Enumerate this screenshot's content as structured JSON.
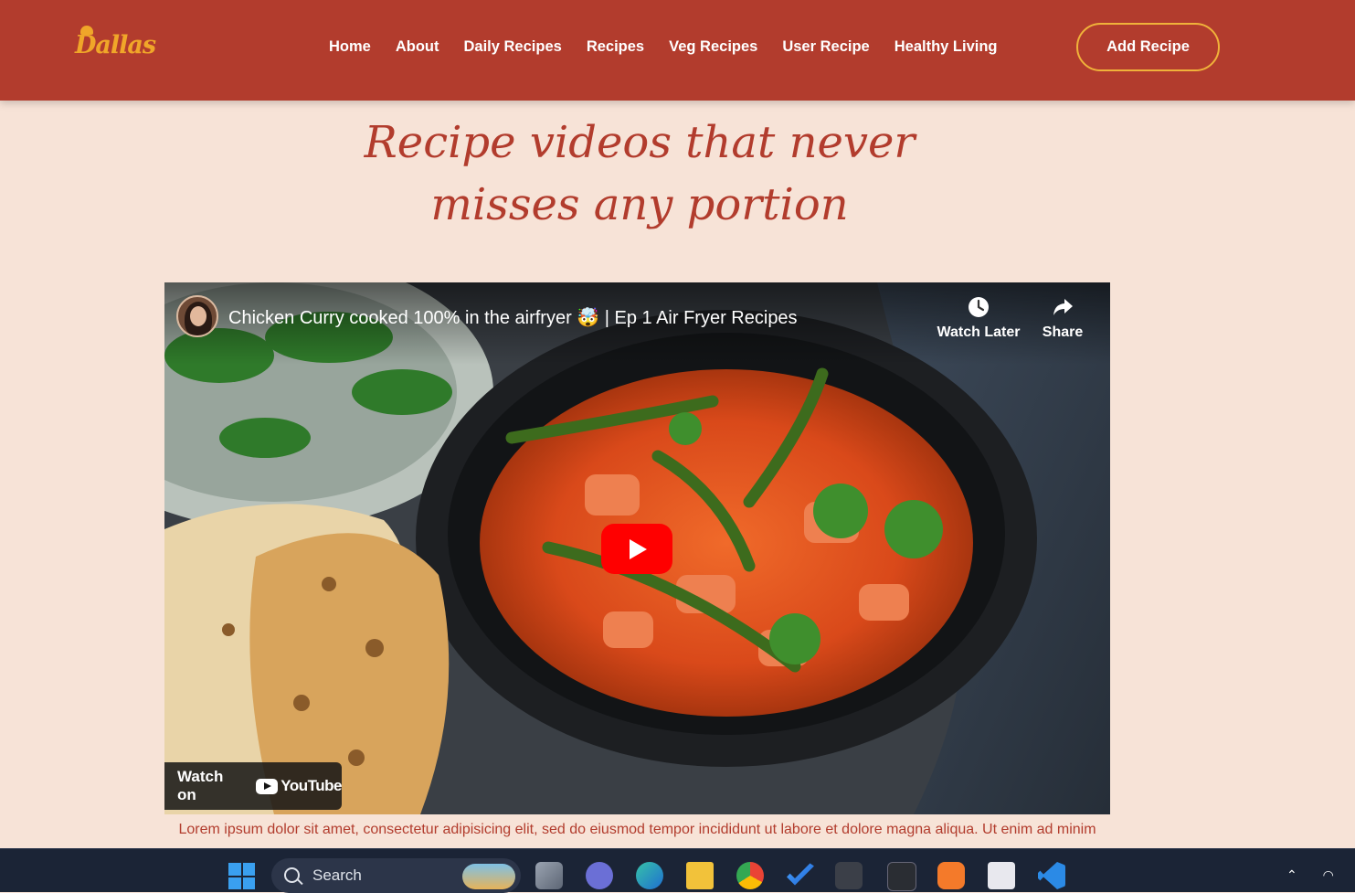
{
  "brand": {
    "logo_text": "Dallas"
  },
  "nav": {
    "items": [
      "Home",
      "About",
      "Daily Recipes",
      "Recipes",
      "Veg Recipes",
      "User Recipe",
      "Healthy Living"
    ],
    "cta": "Add Recipe"
  },
  "hero": {
    "line1": "Recipe videos that never",
    "line2": "misses any portion"
  },
  "video": {
    "title": "Chicken Curry cooked 100% in the airfryer 🤯 | Ep 1 Air Fryer Recipes",
    "watch_later": "Watch Later",
    "share": "Share",
    "watch_on": "Watch on",
    "youtube": "YouTube"
  },
  "description": "Lorem ipsum dolor sit amet, consectetur adipisicing elit, sed do eiusmod tempor incididunt ut labore et dolore magna aliqua. Ut enim ad minim",
  "taskbar": {
    "search_placeholder": "Search",
    "apps": [
      "task-view",
      "teams",
      "edge",
      "file-explorer",
      "chrome",
      "todo",
      "chrome-profile",
      "terminal",
      "xampp",
      "snipping-tool",
      "vscode"
    ]
  },
  "colors": {
    "nav_bg": "#b23c2d",
    "page_bg": "#f7e3d7",
    "accent": "#f0a629",
    "text_accent": "#b23c2d"
  }
}
